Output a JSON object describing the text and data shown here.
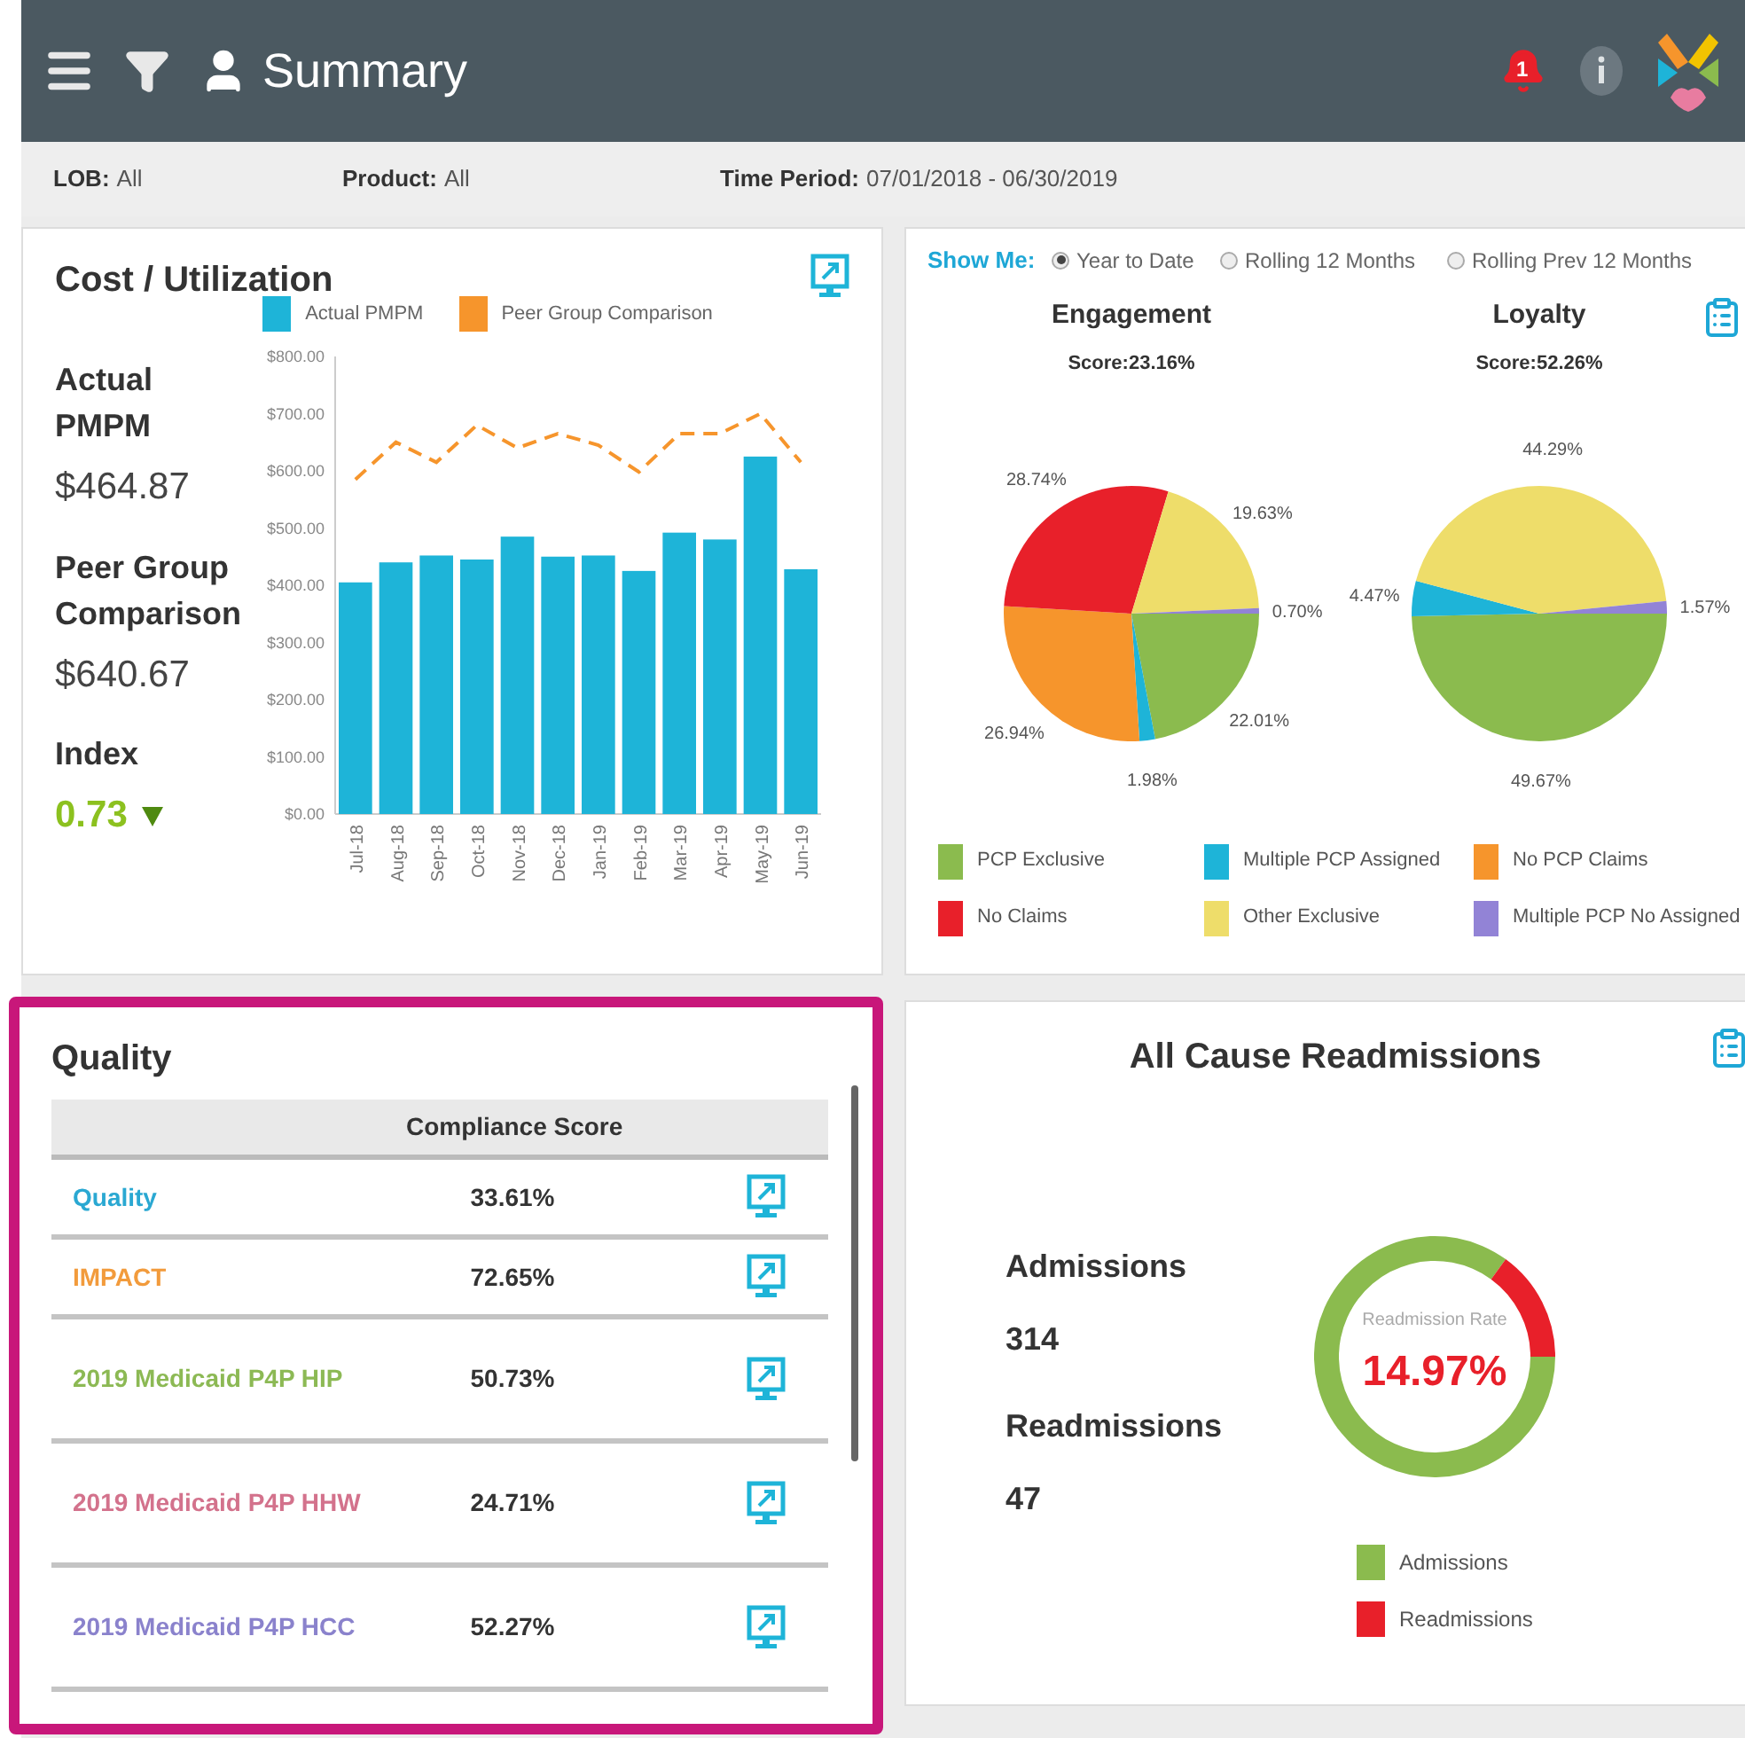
{
  "header": {
    "title": "Summary",
    "notification_count": "1"
  },
  "filters": [
    {
      "label": "LOB:",
      "value": "All"
    },
    {
      "label": "Product:",
      "value": "All"
    },
    {
      "label": "Time Period:",
      "value": "07/01/2018 - 06/30/2019"
    }
  ],
  "cost_utilization": {
    "title": "Cost / Utilization",
    "stats": [
      {
        "label": "Actual PMPM",
        "value": "$464.87"
      },
      {
        "label": "Peer Group Comparison",
        "value": "$640.67"
      },
      {
        "label": "Index",
        "value": "0.73",
        "decreasing": true
      }
    ],
    "chart_data": {
      "type": "bar",
      "categories": [
        "Jul-18",
        "Aug-18",
        "Sep-18",
        "Oct-18",
        "Nov-18",
        "Dec-18",
        "Jan-19",
        "Feb-19",
        "Mar-19",
        "Apr-19",
        "May-19",
        "Jun-19"
      ],
      "series": [
        {
          "name": "Actual PMPM",
          "color": "#1eb4d8",
          "type": "bar",
          "values": [
            405,
            440,
            452,
            445,
            485,
            450,
            452,
            425,
            492,
            480,
            625,
            428
          ]
        },
        {
          "name": "Peer Group Comparison",
          "color": "#f6952c",
          "type": "line",
          "line_style": "dashed",
          "values": [
            585,
            650,
            615,
            680,
            640,
            665,
            645,
            598,
            665,
            665,
            700,
            615
          ]
        }
      ],
      "ylim": [
        0,
        800
      ],
      "yticks": [
        {
          "value": 0,
          "label": "$0.00"
        },
        {
          "value": 100,
          "label": "$100.00"
        },
        {
          "value": 200,
          "label": "$200.00"
        },
        {
          "value": 300,
          "label": "$300.00"
        },
        {
          "value": 400,
          "label": "$400.00"
        },
        {
          "value": 500,
          "label": "$500.00"
        },
        {
          "value": 600,
          "label": "$600.00"
        },
        {
          "value": 700,
          "label": "$700.00"
        },
        {
          "value": 800,
          "label": "$800.00"
        }
      ]
    }
  },
  "member_panel": {
    "show_me_label": "Show Me:",
    "periods": [
      {
        "label": "Year to Date",
        "selected": true
      },
      {
        "label": "Rolling 12 Months",
        "selected": false
      },
      {
        "label": "Rolling Prev 12 Months",
        "selected": false
      }
    ],
    "charts": [
      {
        "title": "Engagement",
        "score": "Score:23.16%",
        "chart_data": {
          "type": "pie",
          "values": [
            22.01,
            1.98,
            26.94,
            28.74,
            19.63,
            0.7
          ],
          "value_labels": [
            "22.01%",
            "1.98%",
            "26.94%",
            "28.74%",
            "19.63%",
            "0.70%"
          ]
        }
      },
      {
        "title": "Loyalty",
        "score": "Score:52.26%",
        "chart_data": {
          "type": "pie",
          "values": [
            49.67,
            4.47,
            null,
            null,
            44.29,
            1.57
          ],
          "value_labels": [
            "49.67%",
            "4.47%",
            null,
            null,
            "44.29%",
            "1.57%"
          ]
        }
      }
    ],
    "legend": [
      {
        "label": "PCP Exclusive",
        "color": "#8bbb4e"
      },
      {
        "label": "Multiple PCP Assigned",
        "color": "#1eb4d8"
      },
      {
        "label": "No PCP Claims",
        "color": "#f6952c"
      },
      {
        "label": "No Claims",
        "color": "#e8202a"
      },
      {
        "label": "Other Exclusive",
        "color": "#eedd6a"
      },
      {
        "label": "Multiple PCP No Assigned",
        "color": "#9283d6"
      }
    ]
  },
  "quality": {
    "title": "Quality",
    "column_header": "Compliance Score",
    "rows": [
      {
        "name": "Quality",
        "score": "33.61%",
        "color": "#2aa8d2"
      },
      {
        "name": "IMPACT",
        "score": "72.65%",
        "color": "#f29b3c"
      },
      {
        "name": "2019 Medicaid P4P HIP",
        "score": "50.73%",
        "color": "#8cb954"
      },
      {
        "name": "2019 Medicaid P4P HHW",
        "score": "24.71%",
        "color": "#d3728c"
      },
      {
        "name": "2019 Medicaid P4P HCC",
        "score": "52.27%",
        "color": "#8a82cc"
      }
    ]
  },
  "readmissions": {
    "title": "All Cause Readmissions",
    "stats": [
      {
        "label": "Admissions",
        "value": "314"
      },
      {
        "label": "Readmissions",
        "value": "47"
      }
    ],
    "center_label": "Readmission Rate",
    "center_value": "14.97%",
    "chart_data": {
      "type": "donut",
      "values": [
        85.03,
        14.97
      ]
    },
    "legend": [
      {
        "label": "Admissions",
        "color": "#8bbb4e"
      },
      {
        "label": "Readmissions",
        "color": "#e8202a"
      }
    ]
  }
}
